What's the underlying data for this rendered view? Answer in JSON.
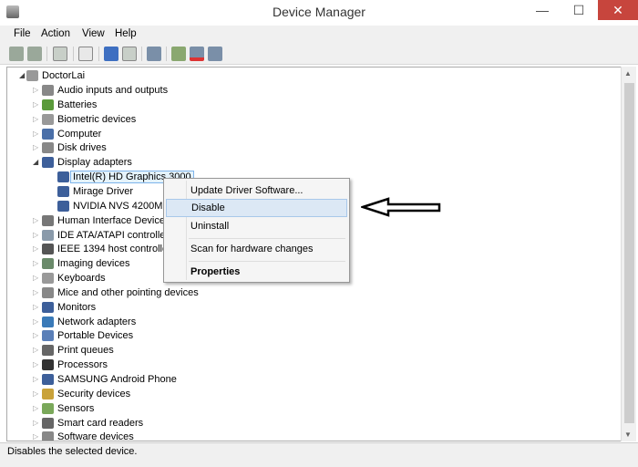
{
  "window": {
    "title": "Device Manager",
    "minimize": "—",
    "maximize": "☐",
    "close": "✕"
  },
  "menubar": [
    "File",
    "Action",
    "View",
    "Help"
  ],
  "toolbar": [
    "back-icon",
    "forward-icon",
    "show-hide-console-tree-icon",
    "properties-icon",
    "help-icon",
    "action-pane-icon",
    "scan-hardware-icon",
    "update-driver-icon",
    "disable-device-icon",
    "uninstall-device-icon"
  ],
  "tree": {
    "root": "DoctorLai",
    "items": [
      {
        "label": "Audio inputs and outputs",
        "expanded": false
      },
      {
        "label": "Batteries",
        "expanded": false
      },
      {
        "label": "Biometric devices",
        "expanded": false
      },
      {
        "label": "Computer",
        "expanded": false
      },
      {
        "label": "Disk drives",
        "expanded": false
      },
      {
        "label": "Display adapters",
        "expanded": true,
        "children": [
          "Intel(R) HD Graphics 3000",
          "Mirage Driver",
          "NVIDIA NVS 4200M"
        ]
      },
      {
        "label": "Human Interface Devices",
        "expanded": false
      },
      {
        "label": "IDE ATA/ATAPI controllers",
        "expanded": false
      },
      {
        "label": "IEEE 1394 host controllers",
        "expanded": false
      },
      {
        "label": "Imaging devices",
        "expanded": false
      },
      {
        "label": "Keyboards",
        "expanded": false
      },
      {
        "label": "Mice and other pointing devices",
        "expanded": false
      },
      {
        "label": "Monitors",
        "expanded": false
      },
      {
        "label": "Network adapters",
        "expanded": false
      },
      {
        "label": "Portable Devices",
        "expanded": false
      },
      {
        "label": "Print queues",
        "expanded": false
      },
      {
        "label": "Processors",
        "expanded": false
      },
      {
        "label": "SAMSUNG Android Phone",
        "expanded": false
      },
      {
        "label": "Security devices",
        "expanded": false
      },
      {
        "label": "Sensors",
        "expanded": false
      },
      {
        "label": "Smart card readers",
        "expanded": false
      },
      {
        "label": "Software devices",
        "expanded": false
      }
    ],
    "selected": "Intel(R) HD Graphics 3000"
  },
  "context_menu": {
    "items": [
      "Update Driver Software...",
      "Disable",
      "Uninstall",
      "Scan for hardware changes",
      "Properties"
    ],
    "highlighted": "Disable"
  },
  "status": "Disables the selected device."
}
